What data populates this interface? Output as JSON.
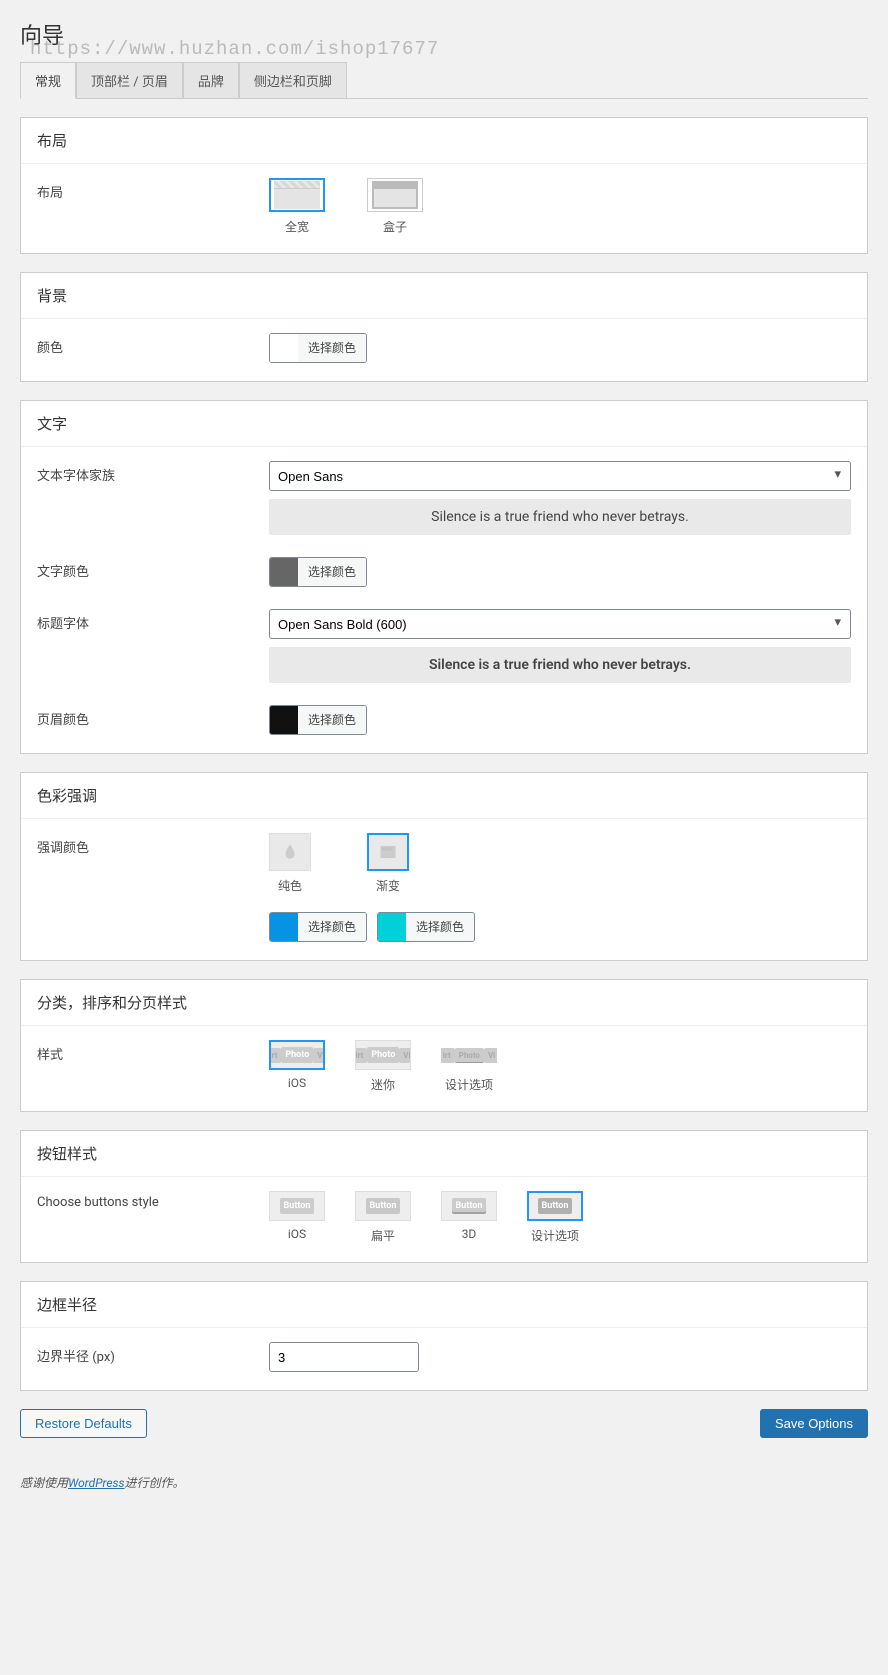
{
  "page_title": "向导",
  "watermark": "https://www.huzhan.com/ishop17677",
  "tabs": [
    "常规",
    "顶部栏 / 页眉",
    "品牌",
    "侧边栏和页脚"
  ],
  "sections": {
    "layout": {
      "title": "布局",
      "label": "布局",
      "options": [
        "全宽",
        "盒子"
      ]
    },
    "background": {
      "title": "背景",
      "label": "颜色",
      "pick": "选择颜色"
    },
    "text": {
      "title": "文字",
      "font_family_label": "文本字体家族",
      "font_family_value": "Open Sans",
      "preview": "Silence is a true friend who never betrays.",
      "text_color_label": "文字颜色",
      "pick": "选择颜色",
      "heading_font_label": "标题字体",
      "heading_font_value": "Open Sans Bold (600)",
      "header_color_label": "页眉颜色"
    },
    "accent": {
      "title": "色彩强调",
      "label": "强调颜色",
      "options": [
        "纯色",
        "渐变"
      ],
      "pick": "选择颜色"
    },
    "cat_style": {
      "title": "分类，排序和分页样式",
      "label": "样式",
      "options": [
        "iOS",
        "迷你",
        "设计选项"
      ]
    },
    "btn_style": {
      "title": "按钮样式",
      "label": "Choose buttons style",
      "chip": "Button",
      "options": [
        "iOS",
        "扁平",
        "3D",
        "设计选项"
      ]
    },
    "radius": {
      "title": "边框半径",
      "label": "边界半径 (px)",
      "value": "3"
    }
  },
  "buttons": {
    "restore": "Restore Defaults",
    "save": "Save Options"
  },
  "footer": {
    "thanks_pre": "感谢使用",
    "wp": "WordPress",
    "thanks_post": "进行创作。"
  }
}
